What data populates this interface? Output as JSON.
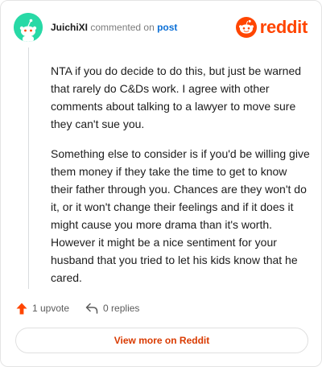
{
  "comment": {
    "username": "JuichiXI",
    "action": "commented on",
    "target_link": "post",
    "paragraphs": [
      "NTA if you do decide to do this, but just be warned that rarely do C&Ds work. I agree with other comments about talking to a lawyer to move sure they can't sue you.",
      "Something else to consider is if you'd be willing give them money if they take the time to get to know their father through you. Chances are they won't do it, or it won't change their feelings and if it does it might cause you more drama than it's worth. However it might be a nice sentiment for your husband that you tried to let his kids know that he cared."
    ]
  },
  "brand": {
    "wordmark": "reddit",
    "icon": "reddit-snoo-icon",
    "color": "#ff4500"
  },
  "avatar": {
    "icon": "snoo-avatar-icon",
    "color": "#28d9a6"
  },
  "actions": {
    "upvote_label": "1 upvote",
    "replies_label": "0 replies",
    "upvote_icon": "upvote-arrow-icon",
    "reply_icon": "reply-arrow-icon",
    "upvote_color": "#ff4500"
  },
  "footer": {
    "view_more_label": "View more on Reddit"
  }
}
